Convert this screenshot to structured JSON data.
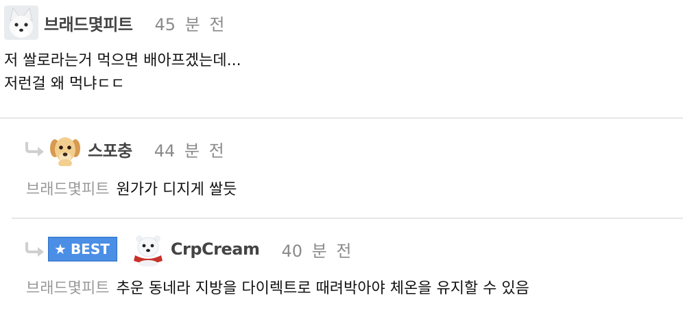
{
  "comments": [
    {
      "avatar": "arctic-fox-avatar",
      "nick": "브래드몇피트",
      "time": "45 분 전",
      "lines": [
        "저 쌀로라는거 먹으면 배아프겠는데...",
        "저런걸 왜 먹냐ㄷㄷ"
      ]
    },
    {
      "avatar": "puppy-avatar",
      "nick": "스포충",
      "time": "44 분 전",
      "mention": "브래드몇피트",
      "text": "원가가 디지게 쌀듯"
    },
    {
      "avatar": "polar-bear-avatar",
      "badge": "BEST",
      "nick": "CrpCream",
      "time": "40 분 전",
      "mention": "브래드몇피트",
      "text": "추운 동네라 지방을 다이렉트로 때려박아야 체온을 유지할 수 있음"
    }
  ],
  "icons": {
    "reply": "reply-arrow-icon",
    "star": "star-icon"
  },
  "colors": {
    "best_badge": "#4a8ee6",
    "mention": "#999999",
    "nick": "#444444",
    "time": "#8a8a8a"
  }
}
